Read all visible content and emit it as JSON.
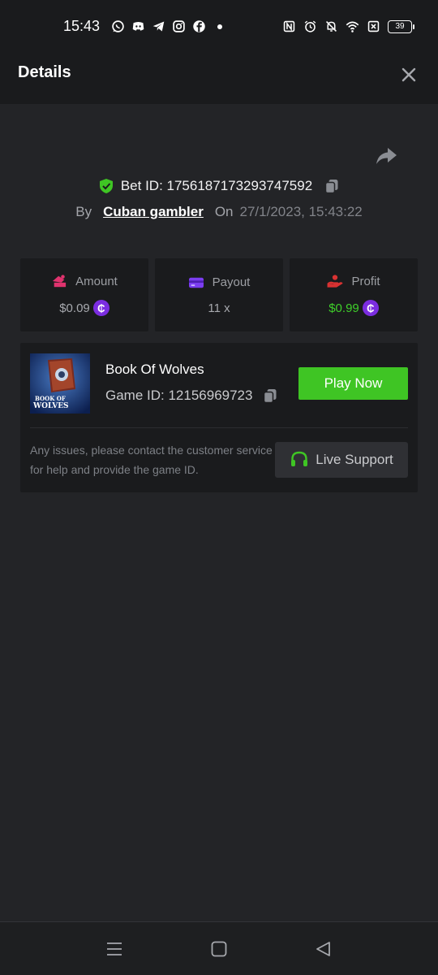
{
  "status_bar": {
    "time": "15:43",
    "battery": "39",
    "left_icons": [
      "whatsapp-icon",
      "discord-icon",
      "telegram-icon",
      "instagram-icon",
      "facebook-icon"
    ],
    "right_icons": [
      "nfc-icon",
      "alarm-icon",
      "mute-icon",
      "wifi-icon",
      "sim-icon",
      "battery-icon"
    ]
  },
  "header": {
    "title": "Details"
  },
  "bet": {
    "id_text": "Bet ID: 1756187173293747592",
    "by_label": "By",
    "user": "Cuban gambler",
    "on_label": "On",
    "date": "27/1/2023, 15:43:22"
  },
  "stats": {
    "amount": {
      "label": "Amount",
      "value": "$0.09",
      "coin_glyph": "₵"
    },
    "payout": {
      "label": "Payout",
      "value": "11 x"
    },
    "profit": {
      "label": "Profit",
      "value": "$0.99",
      "coin_glyph": "₵"
    }
  },
  "game": {
    "name": "Book Of Wolves",
    "id_text": "Game ID: 12156969723",
    "thumb_line1": "BOOK OF",
    "thumb_line2": "WOLVES",
    "play_label": "Play Now",
    "issues_text": "Any issues, please contact the customer service for help and provide the game ID.",
    "live_support_label": "Live Support"
  },
  "colors": {
    "background": "#232427",
    "panel": "#1a1b1d",
    "green": "#3fc524",
    "coin": "#7b2de0",
    "amount_icon": "#e0336e",
    "payout_icon": "#7b3df0",
    "profit_icon": "#d93232"
  },
  "nav": {
    "icons": [
      "recents-icon",
      "home-icon",
      "back-icon"
    ]
  }
}
